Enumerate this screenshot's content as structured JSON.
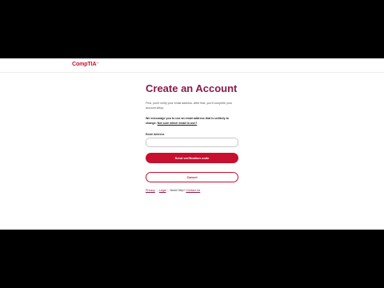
{
  "header": {
    "logo_text": "CompTIA",
    "logo_tm": "™"
  },
  "main": {
    "title": "Create an Account",
    "intro": "First, you'll verify your email address. After that, you'll complete your account setup.",
    "encourage_text": "We encourage you to use an email address that is unlikely to change.",
    "encourage_link": "Not sure which email to use?",
    "email_label": "Email Address",
    "email_value": "",
    "email_placeholder": "",
    "send_button": "Send verification code",
    "cancel_button": "Cancel"
  },
  "footer": {
    "privacy": "Privacy",
    "legal": "Legal",
    "need_help": "Need Help?",
    "contact": "Contact Us",
    "separator": "|"
  },
  "colors": {
    "brand": "#c8102e",
    "title": "#8b1a4a"
  }
}
